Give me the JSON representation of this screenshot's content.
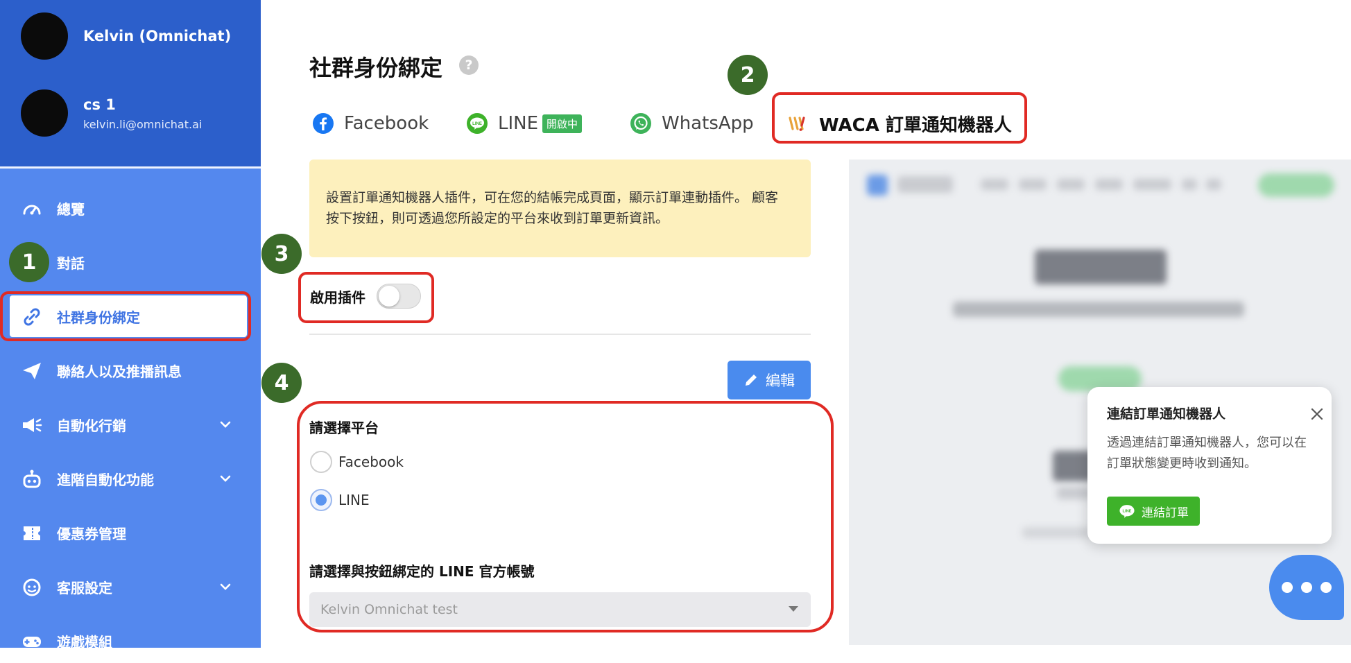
{
  "sidebar": {
    "profile": {
      "name": "Kelvin (Omnichat)"
    },
    "account": {
      "name": "cs 1",
      "email": "kelvin.li@omnichat.ai"
    },
    "items": [
      {
        "label": "總覽",
        "icon": "dashboard-icon"
      },
      {
        "label": "對話",
        "icon": "chat-icon"
      },
      {
        "label": "社群身份綁定",
        "icon": "link-icon",
        "active": true
      },
      {
        "label": "聯絡人以及推播訊息",
        "icon": "send-icon"
      },
      {
        "label": "自動化行銷",
        "icon": "megaphone-icon",
        "expandable": true
      },
      {
        "label": "進階自動化功能",
        "icon": "robot-icon",
        "expandable": true
      },
      {
        "label": "優惠券管理",
        "icon": "coupon-icon"
      },
      {
        "label": "客服設定",
        "icon": "agent-icon",
        "expandable": true
      },
      {
        "label": "遊戲模組",
        "icon": "gamepad-icon"
      }
    ]
  },
  "page": {
    "title": "社群身份綁定",
    "help": "?"
  },
  "tabs": [
    {
      "label": "Facebook",
      "icon": "facebook-icon"
    },
    {
      "label": "LINE",
      "icon": "line-icon",
      "badge": "開啟中"
    },
    {
      "label": "WhatsApp",
      "icon": "whatsapp-icon"
    },
    {
      "label": "WACA 訂單通知機器人",
      "icon": "waca-icon",
      "active": true
    }
  ],
  "notice": {
    "line1": "設置訂單通知機器人插件，可在您的結帳完成頁面，顯示訂單連動插件。 顧客",
    "line2": "按下按鈕，則可透過您所設定的平台來收到訂單更新資訊。"
  },
  "plugin": {
    "enable_label": "啟用插件",
    "enabled": false
  },
  "edit_button": {
    "label": "編輯",
    "icon": "pencil-icon"
  },
  "platform": {
    "label": "請選擇平台",
    "options": [
      {
        "label": "Facebook",
        "selected": false
      },
      {
        "label": "LINE",
        "selected": true
      }
    ]
  },
  "account_select": {
    "label": "請選擇與按鈕綁定的 LINE 官方帳號",
    "value": "Kelvin Omnichat test"
  },
  "callouts": [
    "1",
    "2",
    "3",
    "4"
  ],
  "popup": {
    "title": "連結訂單通知機器人",
    "description": "透過連結訂單通知機器人，您可以在訂單狀態變更時收到通知。",
    "button_label": "連結訂單",
    "button_icon": "line-icon"
  },
  "colors": {
    "sidebar": "#5488ee",
    "sidebar_header": "#2c5fcb",
    "accent": "#4a8bee",
    "line_green": "#3eb22a",
    "callout_red": "#e02a24",
    "badge_green": "#3b6b2a",
    "notice_bg": "#fdf0bd"
  }
}
